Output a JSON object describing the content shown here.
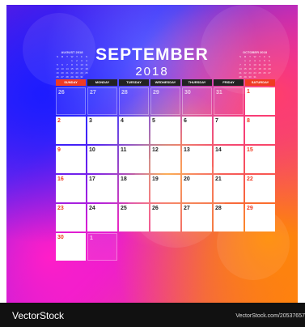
{
  "title": "SEPTEMBER",
  "year": "2018",
  "weekdays": [
    "SUNDAY",
    "MONDAY",
    "TUESDAY",
    "WEDNESDAY",
    "THURSDAY",
    "FRIDAY",
    "SATURDAY"
  ],
  "mini_prev_title": "AUGUST 2018",
  "mini_next_title": "OCTOBER 2018",
  "days": [
    "26",
    "27",
    "28",
    "29",
    "30",
    "31",
    "1",
    "2",
    "3",
    "4",
    "5",
    "6",
    "7",
    "8",
    "9",
    "10",
    "11",
    "12",
    "13",
    "14",
    "15",
    "16",
    "17",
    "18",
    "19",
    "20",
    "21",
    "22",
    "23",
    "24",
    "25",
    "26",
    "27",
    "28",
    "29",
    "30",
    "1"
  ],
  "footer_brand": "VectorStock",
  "footer_url": "VectorStock.com/20537657",
  "colors": {
    "weekend": "#f03b22",
    "header_dark": "#222222"
  }
}
